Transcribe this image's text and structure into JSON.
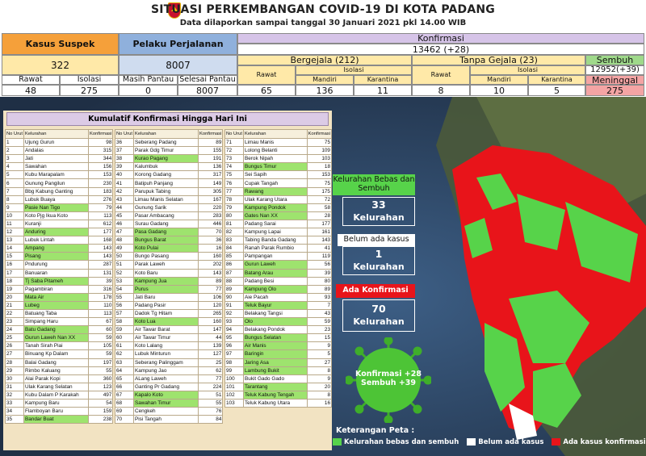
{
  "header": {
    "title": "SITUASI PERKEMBANGAN COVID-19 DI KOTA PADANG",
    "subtitle": "Data dilaporkan sampai tanggal 30 Januari 2021 pkl 14.00 WIB"
  },
  "stats": {
    "suspek": {
      "label": "Kasus Suspek",
      "value": "322",
      "rawat_label": "Rawat",
      "rawat": "48",
      "isolasi_label": "Isolasi",
      "isolasi": "275"
    },
    "perjalanan": {
      "label": "Pelaku Perjalanan",
      "value": "8007",
      "pantau_label": "Masih Pantau",
      "pantau": "0",
      "selesai_label": "Selesai Pantau",
      "selesai": "8007"
    },
    "konfirmasi": {
      "label": "Konfirmasi",
      "value": "13462 (+28)",
      "bergejala": {
        "label": "Bergejala (212)",
        "rawat_label": "Rawat",
        "rawat": "65",
        "isolasi_label": "Isolasi",
        "mandiri_label": "Mandiri",
        "mandiri": "136",
        "karantina_label": "Karantina",
        "karantina": "11"
      },
      "tanpa_gejala": {
        "label": "Tanpa Gejala (23)",
        "rawat_label": "Rawat",
        "rawat": "8",
        "isolasi_label": "Isolasi",
        "mandiri_label": "Mandiri",
        "mandiri": "10",
        "karantina_label": "Karantina",
        "karantina": "5"
      },
      "sembuh": {
        "label": "Sembuh",
        "value": "12952(+39)"
      },
      "meninggal": {
        "label": "Meninggal",
        "value": "275"
      }
    }
  },
  "table": {
    "title": "Kumulatif Konfirmasi Hingga Hari Ini",
    "headers": [
      "No Urut",
      "Kelurahan",
      "Konfirmasi"
    ],
    "columns": [
      [
        [
          "1",
          "Ujung Gurun",
          "98",
          0
        ],
        [
          "2",
          "Andalas",
          "315",
          0
        ],
        [
          "3",
          "Jati",
          "344",
          0
        ],
        [
          "4",
          "Sawahan",
          "156",
          0
        ],
        [
          "5",
          "Kubu Marapalam",
          "153",
          0
        ],
        [
          "6",
          "Gunung Pangilun",
          "230",
          0
        ],
        [
          "7",
          "Bbg Kabung Ganting",
          "183",
          0
        ],
        [
          "8",
          "Lubuk Buaya",
          "276",
          0
        ],
        [
          "9",
          "Pasie Nan Tigo",
          "79",
          1
        ],
        [
          "10",
          "Koto Pjg Ikua Koto",
          "113",
          0
        ],
        [
          "11",
          "Kuranji",
          "612",
          0
        ],
        [
          "12",
          "Anduring",
          "177",
          1
        ],
        [
          "13",
          "Lubuk Lintah",
          "168",
          0
        ],
        [
          "14",
          "Ampang",
          "143",
          1
        ],
        [
          "15",
          "Pisang",
          "143",
          1
        ],
        [
          "16",
          "Pndurung",
          "287",
          0
        ],
        [
          "17",
          "Banuaran",
          "131",
          0
        ],
        [
          "18",
          "Tj Saba Pitameh",
          "39",
          1
        ],
        [
          "19",
          "Pagambiran",
          "316",
          0
        ],
        [
          "20",
          "Mata Air",
          "178",
          1
        ],
        [
          "21",
          "Lubeg",
          "110",
          1
        ],
        [
          "22",
          "Batuang Taba",
          "113",
          0
        ],
        [
          "23",
          "Simpang Haru",
          "67",
          0
        ],
        [
          "24",
          "Batu Gadang",
          "60",
          1
        ],
        [
          "25",
          "Gurun Laweh Nan XX",
          "59",
          1
        ],
        [
          "26",
          "Tanah Sirah Piai",
          "105",
          0
        ],
        [
          "27",
          "Binuang Kp Dalam",
          "59",
          0
        ],
        [
          "28",
          "Balai Gadang",
          "197",
          0
        ],
        [
          "29",
          "Rimbo Kaluang",
          "55",
          0
        ],
        [
          "30",
          "Alai Parak Kopi",
          "360",
          0
        ],
        [
          "31",
          "Ulak Karang Selatan",
          "123",
          0
        ],
        [
          "32",
          "Kubu Dalam P Karakah",
          "497",
          0
        ],
        [
          "33",
          "Kampung Baru",
          "54",
          0
        ],
        [
          "34",
          "Flamboyan Baru",
          "159",
          0
        ],
        [
          "35",
          "Bandar Buat",
          "238",
          1
        ]
      ],
      [
        [
          "36",
          "Seberang Padang",
          "89",
          0
        ],
        [
          "37",
          "Parak Gdg Timur",
          "155",
          0
        ],
        [
          "38",
          "Kurao Pagang",
          "191",
          1
        ],
        [
          "39",
          "Kalumbuk",
          "136",
          0
        ],
        [
          "40",
          "Korong Gadang",
          "317",
          0
        ],
        [
          "41",
          "Batipuh Panjang",
          "149",
          0
        ],
        [
          "42",
          "Parupuk Tabing",
          "305",
          0
        ],
        [
          "43",
          "Limau Manis Selatan",
          "167",
          0
        ],
        [
          "44",
          "Gunung Sarik",
          "220",
          0
        ],
        [
          "45",
          "Pasar Ambacang",
          "283",
          0
        ],
        [
          "46",
          "Surau Gadang",
          "446",
          0
        ],
        [
          "47",
          "Pasa Gadang",
          "70",
          1
        ],
        [
          "48",
          "Bungus Barat",
          "36",
          1
        ],
        [
          "49",
          "Koto Pulai",
          "16",
          1
        ],
        [
          "50",
          "Bungo Pasang",
          "160",
          0
        ],
        [
          "51",
          "Parak Laweh",
          "202",
          0
        ],
        [
          "52",
          "Koto Baru",
          "143",
          0
        ],
        [
          "53",
          "Kampung Jua",
          "89",
          1
        ],
        [
          "54",
          "Purus",
          "77",
          1
        ],
        [
          "55",
          "Jati Baru",
          "106",
          0
        ],
        [
          "56",
          "Padang Pasir",
          "120",
          0
        ],
        [
          "57",
          "Dadok Tg Hitam",
          "265",
          0
        ],
        [
          "58",
          "Koto Lua",
          "160",
          1
        ],
        [
          "59",
          "Air Tawar Barat",
          "147",
          0
        ],
        [
          "60",
          "Air Tawar Timur",
          "44",
          0
        ],
        [
          "61",
          "Koto Lalang",
          "139",
          0
        ],
        [
          "62",
          "Lubuk Minturun",
          "127",
          0
        ],
        [
          "63",
          "Seberang Palinggam",
          "25",
          0
        ],
        [
          "64",
          "Kampung Jao",
          "62",
          0
        ],
        [
          "65",
          "ALang Laweh",
          "77",
          0
        ],
        [
          "66",
          "Ganting Pr Gadang",
          "224",
          0
        ],
        [
          "67",
          "Kapalo Koto",
          "51",
          1
        ],
        [
          "68",
          "Sawahan Timur",
          "55",
          1
        ],
        [
          "69",
          "Cengkeh",
          "76",
          0
        ],
        [
          "70",
          "Pisi Tangah",
          "84",
          0
        ]
      ],
      [
        [
          "71",
          "Limau Manis",
          "75",
          0
        ],
        [
          "72",
          "Lolong Belanti",
          "109",
          0
        ],
        [
          "73",
          "Berok Nipah",
          "103",
          0
        ],
        [
          "74",
          "Bungus Timur",
          "18",
          1
        ],
        [
          "75",
          "Sei Sapih",
          "153",
          0
        ],
        [
          "76",
          "Cupak Tangah",
          "75",
          0
        ],
        [
          "77",
          "Rawang",
          "175",
          1
        ],
        [
          "78",
          "Ulak Karang Utara",
          "72",
          0
        ],
        [
          "79",
          "Kampung Pondok",
          "58",
          1
        ],
        [
          "80",
          "Gates Nan XX",
          "28",
          1
        ],
        [
          "81",
          "Padang Sarai",
          "177",
          0
        ],
        [
          "82",
          "Kampung Lapai",
          "161",
          0
        ],
        [
          "83",
          "Tabing Banda Gadang",
          "143",
          0
        ],
        [
          "84",
          "Ranah Parak Rumbio",
          "41",
          0
        ],
        [
          "85",
          "Pampangan",
          "119",
          0
        ],
        [
          "86",
          "Gurun Laweh",
          "56",
          1
        ],
        [
          "87",
          "Batang Arau",
          "39",
          1
        ],
        [
          "88",
          "Padang Besi",
          "80",
          0
        ],
        [
          "89",
          "Kampung Olo",
          "89",
          1
        ],
        [
          "90",
          "Aie Pacah",
          "93",
          0
        ],
        [
          "91",
          "Teluk Bayur",
          "7",
          1
        ],
        [
          "92",
          "Belakang Tangsi",
          "43",
          0
        ],
        [
          "93",
          "Olo",
          "59",
          1
        ],
        [
          "94",
          "Belakang Pondok",
          "23",
          0
        ],
        [
          "95",
          "Bungus Selatan",
          "15",
          1
        ],
        [
          "96",
          "Air Manis",
          "9",
          1
        ],
        [
          "97",
          "Baringin",
          "5",
          1
        ],
        [
          "98",
          "Jaring Asa",
          "27",
          1
        ],
        [
          "99",
          "Lambung Bukit",
          "8",
          1
        ],
        [
          "100",
          "Bukit Gado Gado",
          "9",
          0
        ],
        [
          "101",
          "Tarantang",
          "20",
          1
        ],
        [
          "102",
          "Teluk Kabung Tengah",
          "8",
          1
        ],
        [
          "103",
          "Teluk Kabung Utara",
          "16",
          0
        ]
      ]
    ]
  },
  "map": {
    "bebas_sembuh": {
      "label": "Kelurahan Bebas dan Sembuh",
      "value": "33",
      "unit": "Kelurahan"
    },
    "belum_ada": {
      "label": "Belum ada kasus",
      "value": "1",
      "unit": "Kelurahan"
    },
    "ada_konfirmasi": {
      "label": "Ada Konfirmasi",
      "value": "70",
      "unit": "Kelurahan"
    },
    "virus": {
      "line1": "Konfirmasi +28",
      "line2": "Sembuh +39"
    },
    "legend": {
      "title": "Keterangan Peta :",
      "green": "Kelurahan bebas dan sembuh",
      "white": "Belum ada kasus",
      "red": "Ada kasus konfirmasi"
    }
  },
  "colors": {
    "orange": "#f5a03a",
    "yellow": "#ffe9a8",
    "blue": "#8fb0dc",
    "lavender": "#d6c4e8",
    "green": "#57d34a",
    "red": "#e8141a"
  }
}
